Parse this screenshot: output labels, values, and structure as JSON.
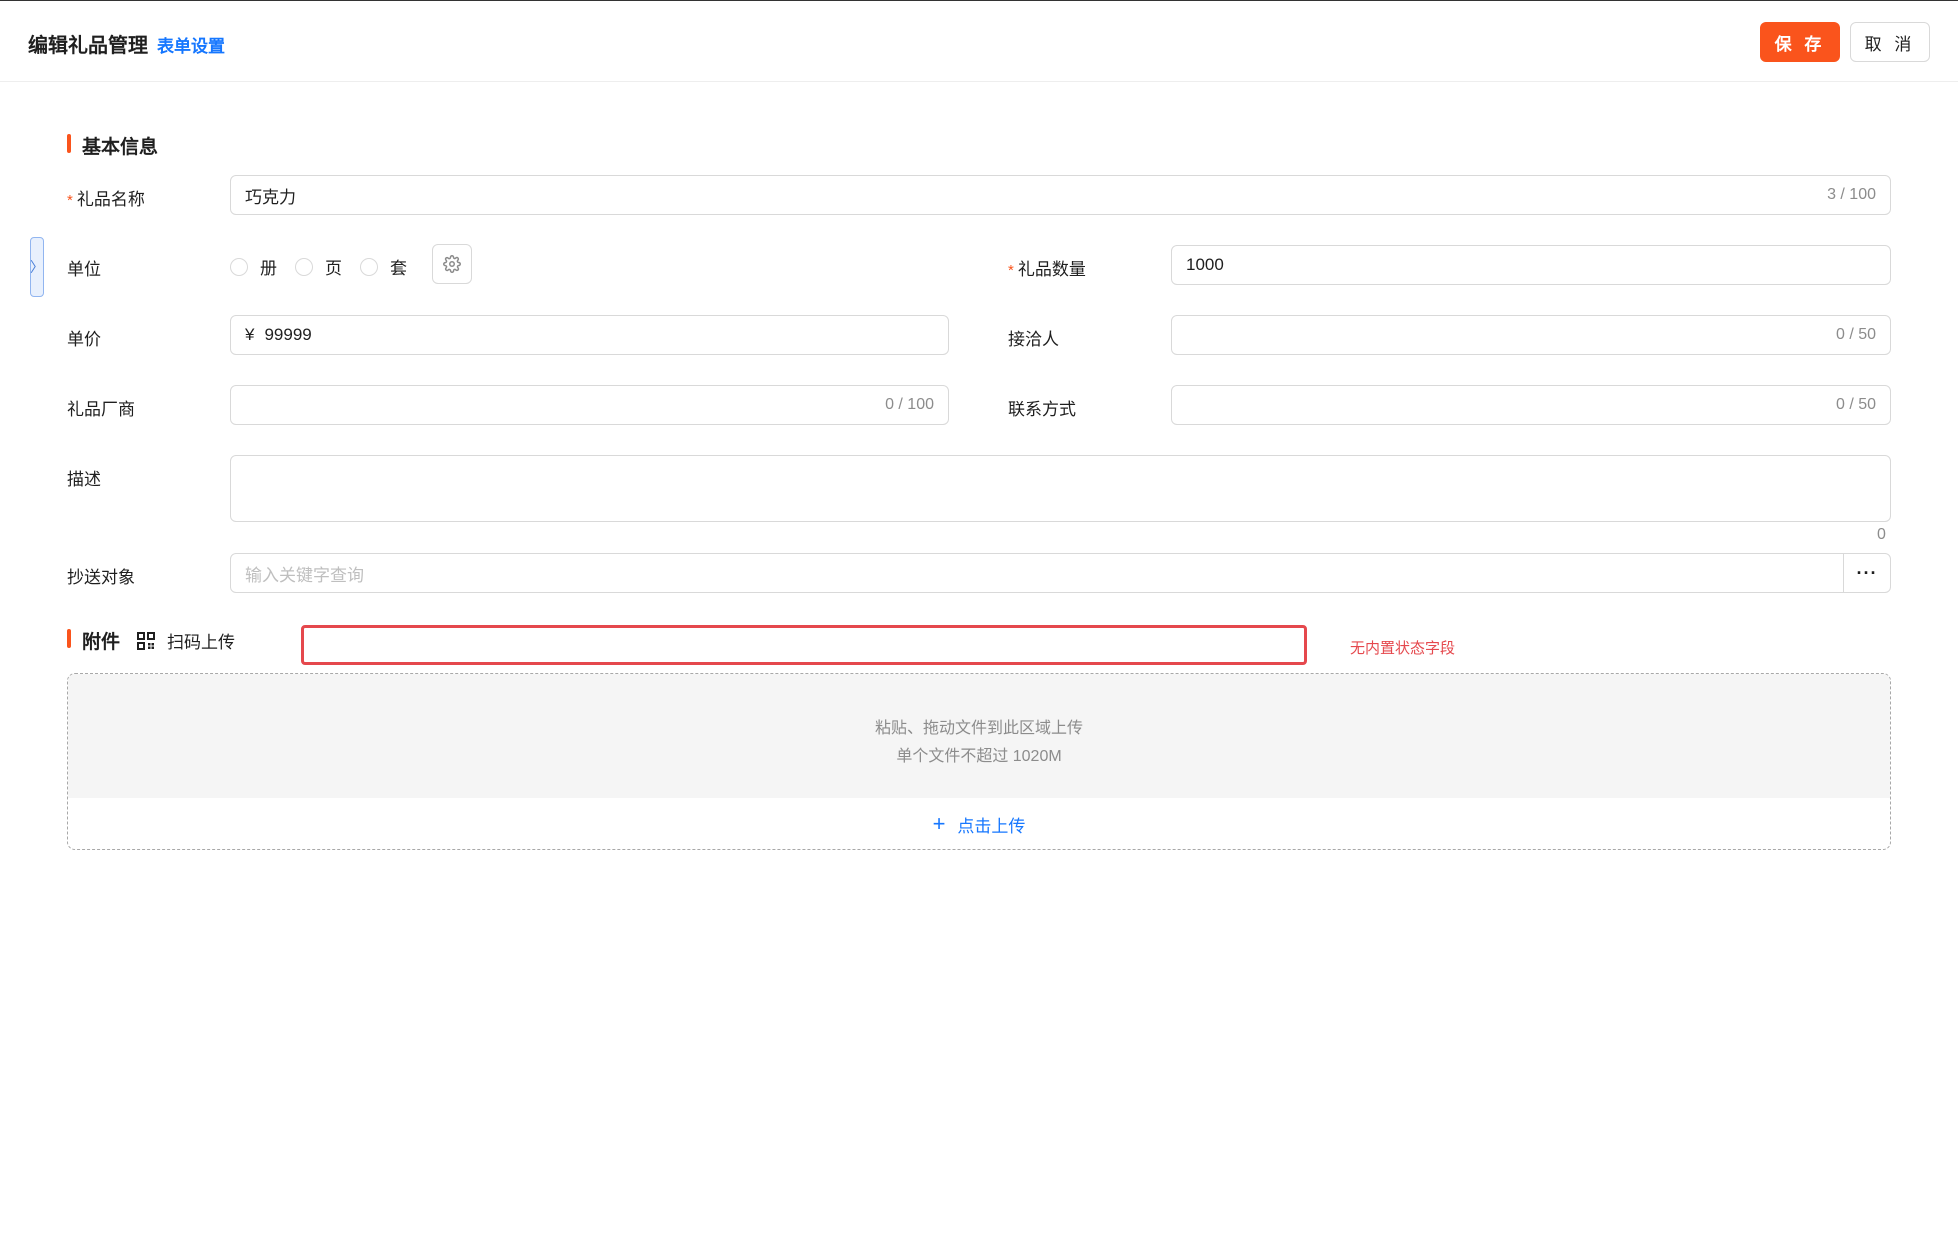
{
  "header": {
    "title": "编辑礼品管理",
    "form_settings_link": "表单设置",
    "save_label": "保 存",
    "cancel_label": "取 消"
  },
  "side_toggle_icon": "chevron-right-icon",
  "basic_info": {
    "section_title": "基本信息",
    "gift_name": {
      "label": "礼品名称",
      "required": true,
      "value": "巧克力",
      "counter": "3 / 100"
    },
    "unit": {
      "label": "单位",
      "options": [
        "册",
        "页",
        "套"
      ],
      "settings_icon": "gear-icon"
    },
    "gift_quantity": {
      "label": "礼品数量",
      "required": true,
      "value": "1000"
    },
    "unit_price": {
      "label": "单价",
      "prefix": "¥",
      "value": "99999"
    },
    "receiver": {
      "label": "接洽人",
      "value": "",
      "counter": "0 / 50"
    },
    "vendor": {
      "label": "礼品厂商",
      "value": "",
      "counter": "0 / 100"
    },
    "contact": {
      "label": "联系方式",
      "value": "",
      "counter": "0 / 50"
    },
    "description": {
      "label": "描述",
      "value": "",
      "counter": "0"
    },
    "cc": {
      "label": "抄送对象",
      "placeholder": "输入关键字查询",
      "more_icon": "ellipsis-icon"
    }
  },
  "attachments": {
    "section_title": "附件",
    "scan_upload_label": "扫码上传",
    "scan_icon": "qr-code-icon",
    "annotation_note": "无内置状态字段",
    "drop_hint_line1": "粘贴、拖动文件到此区域上传",
    "drop_hint_line2": "单个文件不超过 1020M",
    "click_upload_label": "点击上传"
  },
  "colors": {
    "accent": "#fa541c",
    "link": "#1677ff",
    "annotation": "#e5484d"
  }
}
